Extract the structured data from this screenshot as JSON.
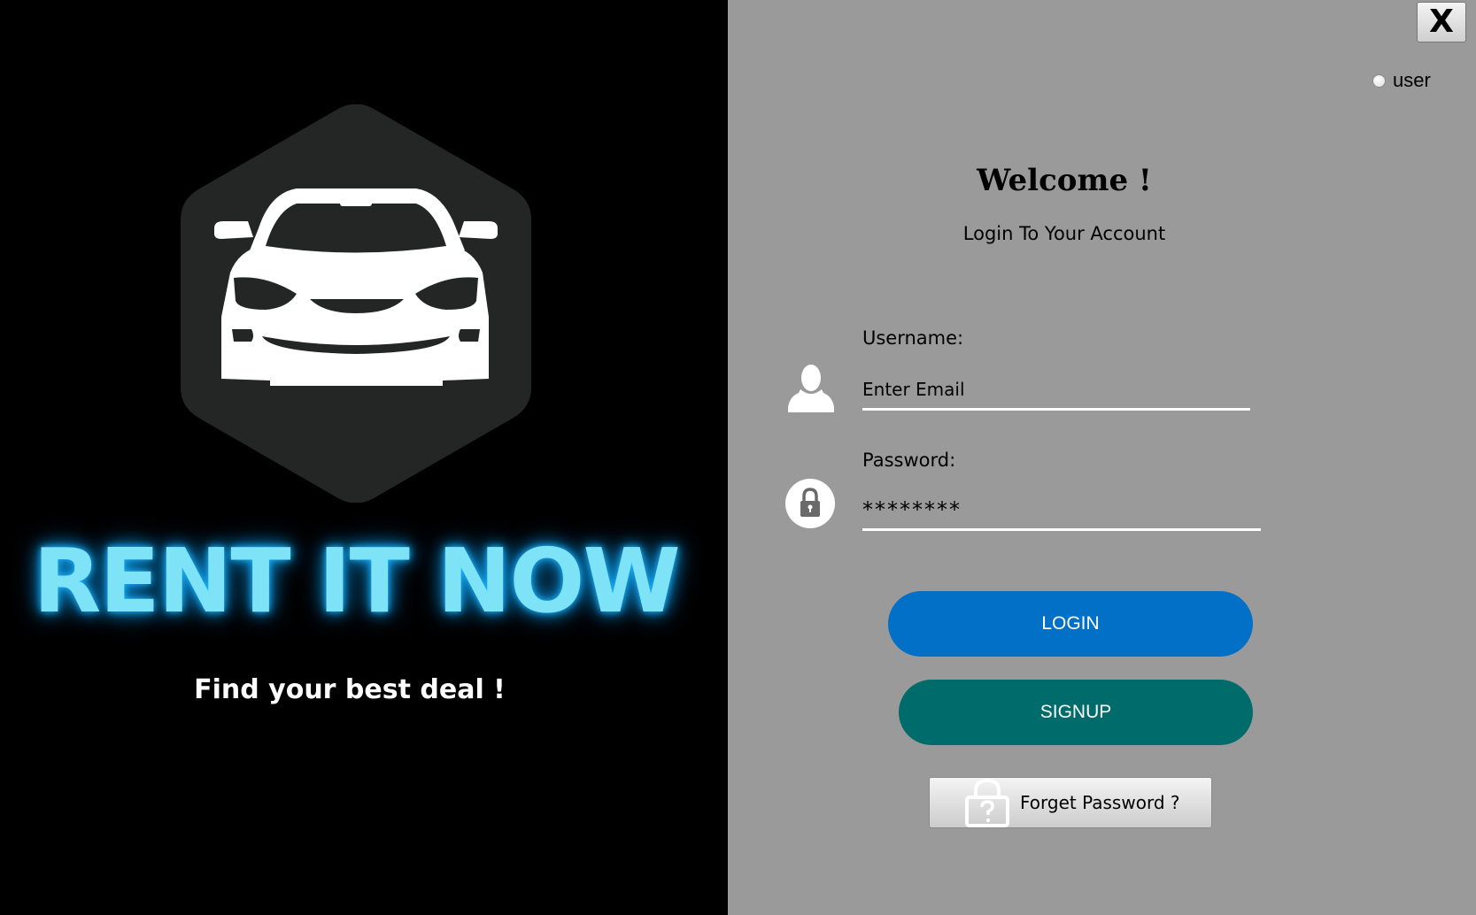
{
  "app": {
    "close_label": "X"
  },
  "branding": {
    "title": "RENT IT NOW",
    "tagline": "Find your best deal !"
  },
  "login": {
    "role_option": "user",
    "welcome": "Welcome !",
    "subtitle": "Login To Your Account",
    "username_label": "Username:",
    "username_value": "Enter Email",
    "password_label": "Password:",
    "password_value": "********",
    "login_button": "LOGIN",
    "signup_button": "SIGNUP",
    "forget_button": "Forget Password ?"
  },
  "colors": {
    "left_background": "#000000",
    "right_background": "#9a9a9a",
    "brand_text": "#7fe3f8",
    "login_button": "#0270c6",
    "signup_button": "#006b6b"
  },
  "icons": {
    "logo": "car-hexagon-logo",
    "username": "user-icon",
    "password": "lock-icon",
    "forget": "lock-question-icon"
  }
}
